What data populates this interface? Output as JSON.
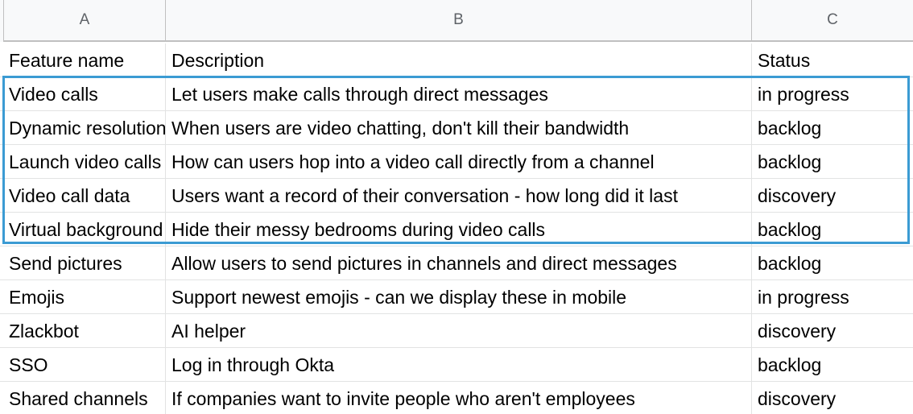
{
  "columns": [
    "A",
    "B",
    "C"
  ],
  "header_row": {
    "a": "Feature name",
    "b": "Description",
    "c": "Status"
  },
  "rows": [
    {
      "a": "Video calls",
      "b": "Let users make calls through direct messages",
      "c": "in progress"
    },
    {
      "a": "Dynamic resolution",
      "b": "When users are video chatting, don't kill their bandwidth",
      "c": "backlog"
    },
    {
      "a": "Launch video calls",
      "b": "How can users hop into a video call directly from a channel",
      "c": "backlog"
    },
    {
      "a": "Video call data",
      "b": "Users want a record of their conversation - how long did it last",
      "c": "discovery"
    },
    {
      "a": "Virtual background",
      "b": "Hide their messy bedrooms during video calls",
      "c": "backlog"
    },
    {
      "a": "Send pictures",
      "b": "Allow users to send pictures in channels and direct messages",
      "c": "backlog"
    },
    {
      "a": "Emojis",
      "b": "Support newest emojis - can we display these in mobile",
      "c": "in progress"
    },
    {
      "a": "Zlackbot",
      "b": "AI helper",
      "c": "discovery"
    },
    {
      "a": "SSO",
      "b": "Log in through Okta",
      "c": "backlog"
    },
    {
      "a": "Shared channels",
      "b": "If companies want to invite people who aren't employees",
      "c": "discovery"
    }
  ],
  "selection": {
    "range": "A2:C6",
    "color": "#3b9bd3"
  },
  "colors": {
    "header_bg": "#f8f9fa",
    "grid_line": "#e2e3e3",
    "header_text": "#5f6368"
  }
}
